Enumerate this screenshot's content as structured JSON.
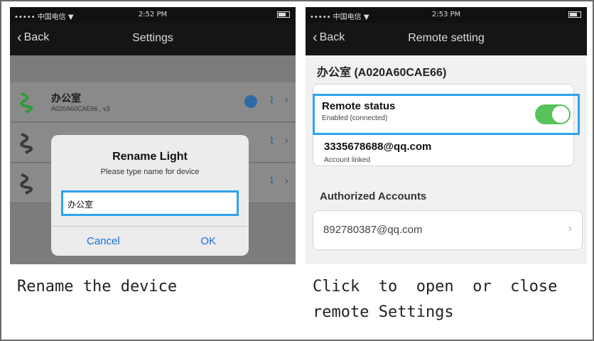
{
  "left_screen": {
    "status": {
      "signal": "••••• 中国电信 ▼",
      "time": "2:52 PM"
    },
    "nav": {
      "back": "Back",
      "title": "Settings"
    },
    "device": {
      "name": "办公室",
      "sub": "A020A60CAE66 , v3"
    },
    "dialog": {
      "title": "Rename Light",
      "message": "Please type name for device",
      "input_value": "办公室",
      "cancel": "Cancel",
      "ok": "OK"
    }
  },
  "right_screen": {
    "status": {
      "signal": "••••• 中国电信 ▼",
      "time": "2:53 PM"
    },
    "nav": {
      "back": "Back",
      "title": "Remote setting"
    },
    "device_header": "办公室 (A020A60CAE66)",
    "remote_status": {
      "label": "Remote status",
      "sub": "Enabled (connected)",
      "enabled": true
    },
    "account": {
      "email": "3335678688@qq.com",
      "sub": "Account linked"
    },
    "authorized": {
      "title": "Authorized Accounts",
      "email": "892780387@qq.com"
    }
  },
  "captions": {
    "left": "Rename the device",
    "right_line1": "Click  to  open  or  close",
    "right_line2": "remote Settings"
  },
  "colors": {
    "highlight": "#2ea3ef",
    "toggle_on": "#58c35a",
    "link": "#1670d6"
  }
}
